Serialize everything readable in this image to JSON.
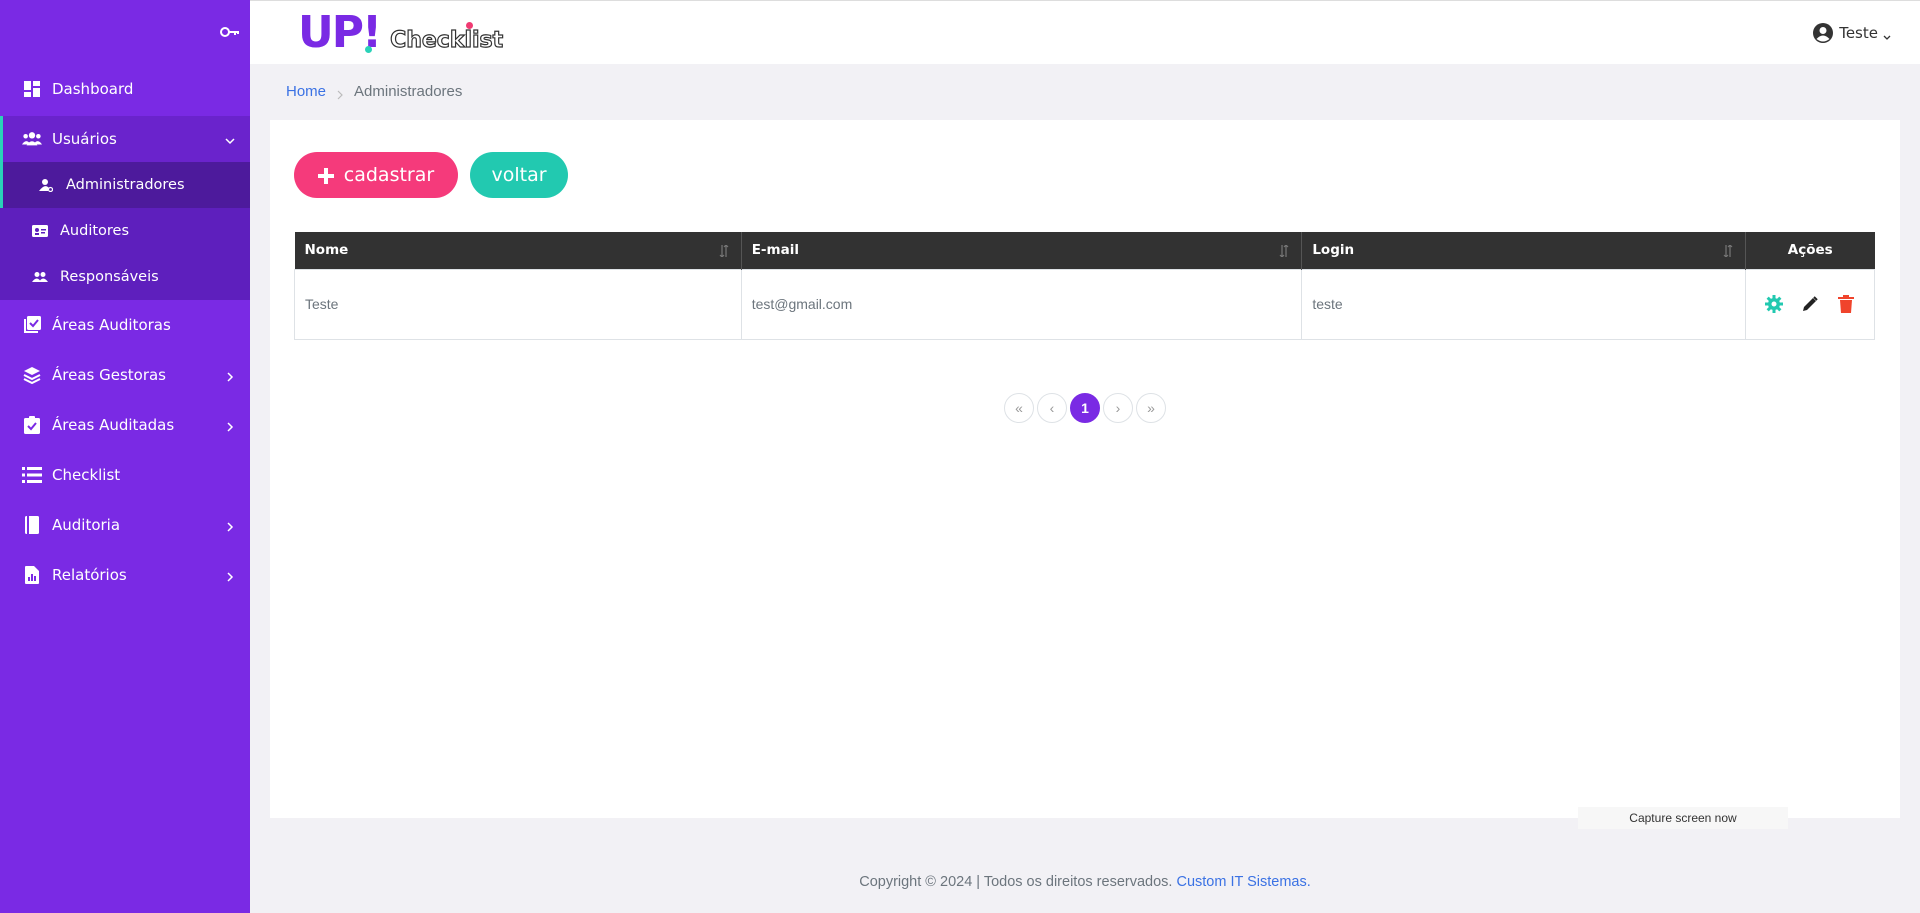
{
  "colors": {
    "sidebar": "#7a2ae4",
    "accent_teal": "#22c9b0",
    "accent_pink": "#f53a7b",
    "link": "#3b72e4"
  },
  "header": {
    "logo_main": "UP",
    "logo_sub": "Checklist",
    "user_name": "Teste",
    "user_icon": "user-circle-icon"
  },
  "sidebar": {
    "toggle_icon": "key-icon",
    "items": [
      {
        "label": "Dashboard",
        "icon": "dashboard-icon"
      },
      {
        "label": "Usuários",
        "icon": "users-icon",
        "expanded": true
      },
      {
        "label": "Áreas Auditoras",
        "icon": "checkbox-list-icon"
      },
      {
        "label": "Áreas Gestoras",
        "icon": "layers-icon"
      },
      {
        "label": "Áreas Auditadas",
        "icon": "clipboard-check-icon"
      },
      {
        "label": "Checklist",
        "icon": "list-icon"
      },
      {
        "label": "Auditoria",
        "icon": "book-icon"
      },
      {
        "label": "Relatórios",
        "icon": "report-icon"
      }
    ],
    "sub_items": [
      {
        "label": "Administradores",
        "icon": "user-cog-icon",
        "active": true
      },
      {
        "label": "Auditores",
        "icon": "id-card-icon"
      },
      {
        "label": "Responsáveis",
        "icon": "user-group-icon"
      }
    ]
  },
  "breadcrumb": {
    "home": "Home",
    "current": "Administradores"
  },
  "buttons": {
    "add": "cadastrar",
    "back": "voltar"
  },
  "table": {
    "columns": [
      "Nome",
      "E-mail",
      "Login",
      "Ações"
    ],
    "rows": [
      {
        "nome": "Teste",
        "email": "test@gmail.com",
        "login": "teste"
      }
    ]
  },
  "pagination": {
    "first": "«",
    "prev": "‹",
    "current": "1",
    "next": "›",
    "last": "»"
  },
  "capture_label": "Capture screen now",
  "footer": {
    "text": "Copyright © 2024 | Todos os direitos reservados. ",
    "link": "Custom IT Sistemas."
  }
}
